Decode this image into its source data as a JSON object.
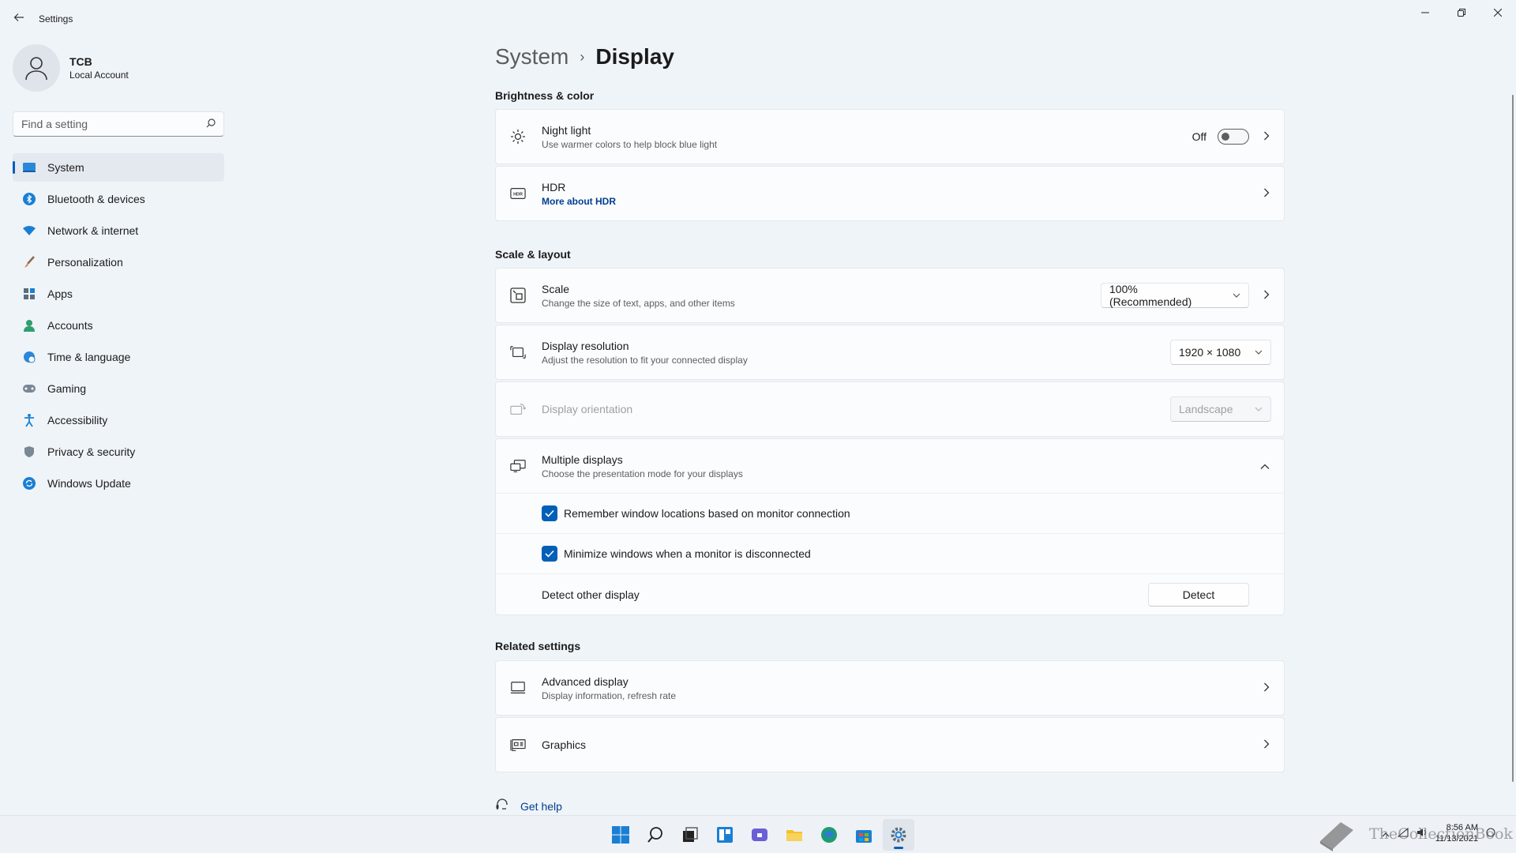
{
  "window": {
    "title": "Settings"
  },
  "profile": {
    "name": "TCB",
    "account_type": "Local Account"
  },
  "search": {
    "placeholder": "Find a setting"
  },
  "sidebar": {
    "items": [
      {
        "label": "System",
        "icon": "system-icon",
        "active": true
      },
      {
        "label": "Bluetooth & devices",
        "icon": "bluetooth-icon"
      },
      {
        "label": "Network & internet",
        "icon": "wifi-icon"
      },
      {
        "label": "Personalization",
        "icon": "brush-icon"
      },
      {
        "label": "Apps",
        "icon": "apps-icon"
      },
      {
        "label": "Accounts",
        "icon": "person-icon"
      },
      {
        "label": "Time & language",
        "icon": "globe-clock-icon"
      },
      {
        "label": "Gaming",
        "icon": "gamepad-icon"
      },
      {
        "label": "Accessibility",
        "icon": "accessibility-icon"
      },
      {
        "label": "Privacy & security",
        "icon": "shield-icon"
      },
      {
        "label": "Windows Update",
        "icon": "update-icon"
      }
    ]
  },
  "breadcrumb": {
    "parent": "System",
    "separator": "›",
    "current": "Display"
  },
  "sections": {
    "brightness": "Brightness & color",
    "scale_layout": "Scale & layout",
    "related": "Related settings"
  },
  "night_light": {
    "title": "Night light",
    "subtitle": "Use warmer colors to help block blue light",
    "state_label": "Off"
  },
  "hdr": {
    "title": "HDR",
    "link": "More about HDR"
  },
  "scale": {
    "title": "Scale",
    "subtitle": "Change the size of text, apps, and other items",
    "value": "100% (Recommended)"
  },
  "resolution": {
    "title": "Display resolution",
    "subtitle": "Adjust the resolution to fit your connected display",
    "value": "1920 × 1080"
  },
  "orientation": {
    "title": "Display orientation",
    "value": "Landscape"
  },
  "multiple_displays": {
    "title": "Multiple displays",
    "subtitle": "Choose the presentation mode for your displays",
    "remember_label": "Remember window locations based on monitor connection",
    "minimize_label": "Minimize windows when a monitor is disconnected",
    "detect_label": "Detect other display",
    "detect_button": "Detect"
  },
  "advanced_display": {
    "title": "Advanced display",
    "subtitle": "Display information, refresh rate"
  },
  "graphics": {
    "title": "Graphics"
  },
  "help": {
    "label": "Get help"
  },
  "taskbar": {
    "time": "8:56 AM",
    "date": "11/13/2021",
    "watermark": "TheCollectionBook"
  },
  "colors": {
    "accent": "#005fb8",
    "background": "#eff4f9",
    "card": "#fbfcfd"
  }
}
